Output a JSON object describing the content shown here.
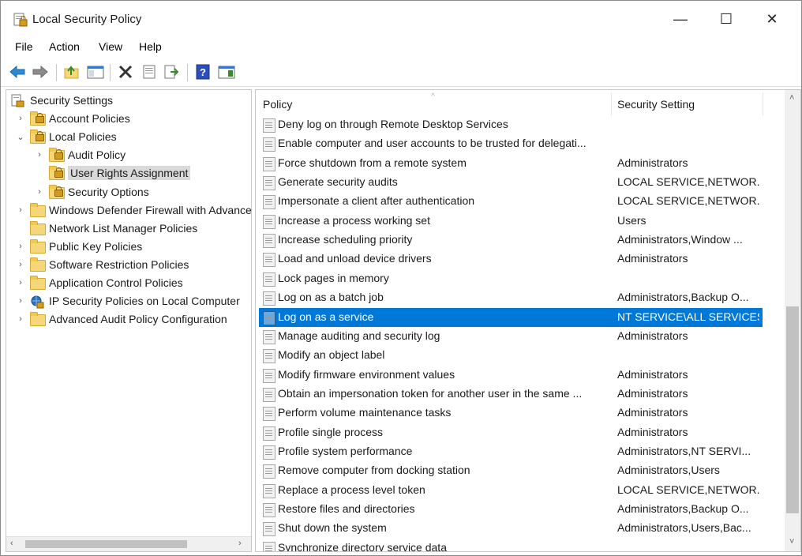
{
  "window": {
    "title": "Local Security Policy",
    "controls": {
      "minimize": "—",
      "maximize": "☐",
      "close": "✕"
    }
  },
  "menu": [
    "File",
    "Action",
    "View",
    "Help"
  ],
  "toolbar": {
    "back_icon": "back-arrow-icon",
    "forward_icon": "forward-arrow-icon",
    "up_icon": "up-folder-icon",
    "show_hide_icon": "show-hide-tree-icon",
    "delete_icon": "delete-icon",
    "properties_icon": "properties-icon",
    "export_icon": "export-list-icon",
    "help_icon": "help-icon",
    "action_pane_icon": "action-pane-icon"
  },
  "tree": [
    {
      "label": "Security Settings",
      "level": 0,
      "expander": "",
      "icon": "root"
    },
    {
      "label": "Account Policies",
      "level": 1,
      "expander": "›",
      "icon": "lockfolder"
    },
    {
      "label": "Local Policies",
      "level": 1,
      "expander": "⌄",
      "icon": "lockfolder"
    },
    {
      "label": "Audit Policy",
      "level": 2,
      "expander": "›",
      "icon": "lockfolder"
    },
    {
      "label": "User Rights Assignment",
      "level": 2,
      "expander": "",
      "icon": "lockfolder",
      "selected": true
    },
    {
      "label": "Security Options",
      "level": 2,
      "expander": "›",
      "icon": "lockfolder"
    },
    {
      "label": "Windows Defender Firewall with Advanced Security",
      "level": 1,
      "expander": "›",
      "icon": "folder"
    },
    {
      "label": "Network List Manager Policies",
      "level": 1,
      "expander": "",
      "icon": "folder"
    },
    {
      "label": "Public Key Policies",
      "level": 1,
      "expander": "›",
      "icon": "folder"
    },
    {
      "label": "Software Restriction Policies",
      "level": 1,
      "expander": "›",
      "icon": "folder"
    },
    {
      "label": "Application Control Policies",
      "level": 1,
      "expander": "›",
      "icon": "folder"
    },
    {
      "label": "IP Security Policies on Local Computer",
      "level": 1,
      "expander": "›",
      "icon": "ipsec"
    },
    {
      "label": "Advanced Audit Policy Configuration",
      "level": 1,
      "expander": "›",
      "icon": "folder"
    }
  ],
  "list": {
    "columns": {
      "policy": "Policy",
      "setting": "Security Setting"
    },
    "rows": [
      {
        "policy": "Deny log on through Remote Desktop Services",
        "setting": ""
      },
      {
        "policy": "Enable computer and user accounts to be trusted for delegati...",
        "setting": ""
      },
      {
        "policy": "Force shutdown from a remote system",
        "setting": "Administrators"
      },
      {
        "policy": "Generate security audits",
        "setting": "LOCAL SERVICE,NETWOR..."
      },
      {
        "policy": "Impersonate a client after authentication",
        "setting": "LOCAL SERVICE,NETWOR..."
      },
      {
        "policy": "Increase a process working set",
        "setting": "Users"
      },
      {
        "policy": "Increase scheduling priority",
        "setting": "Administrators,Window ..."
      },
      {
        "policy": "Load and unload device drivers",
        "setting": "Administrators"
      },
      {
        "policy": "Lock pages in memory",
        "setting": ""
      },
      {
        "policy": "Log on as a batch job",
        "setting": "Administrators,Backup O..."
      },
      {
        "policy": "Log on as a service",
        "setting": "NT SERVICE\\ALL SERVICES",
        "selected": true
      },
      {
        "policy": "Manage auditing and security log",
        "setting": "Administrators"
      },
      {
        "policy": "Modify an object label",
        "setting": ""
      },
      {
        "policy": "Modify firmware environment values",
        "setting": "Administrators"
      },
      {
        "policy": "Obtain an impersonation token for another user in the same ...",
        "setting": "Administrators"
      },
      {
        "policy": "Perform volume maintenance tasks",
        "setting": "Administrators"
      },
      {
        "policy": "Profile single process",
        "setting": "Administrators"
      },
      {
        "policy": "Profile system performance",
        "setting": "Administrators,NT SERVI..."
      },
      {
        "policy": "Remove computer from docking station",
        "setting": "Administrators,Users"
      },
      {
        "policy": "Replace a process level token",
        "setting": "LOCAL SERVICE,NETWOR..."
      },
      {
        "policy": "Restore files and directories",
        "setting": "Administrators,Backup O..."
      },
      {
        "policy": "Shut down the system",
        "setting": "Administrators,Users,Bac..."
      },
      {
        "policy": "Synchronize directory service data",
        "setting": ""
      }
    ]
  },
  "colors": {
    "selection": "#0078d7",
    "tree_selection": "#d9d9d9"
  }
}
